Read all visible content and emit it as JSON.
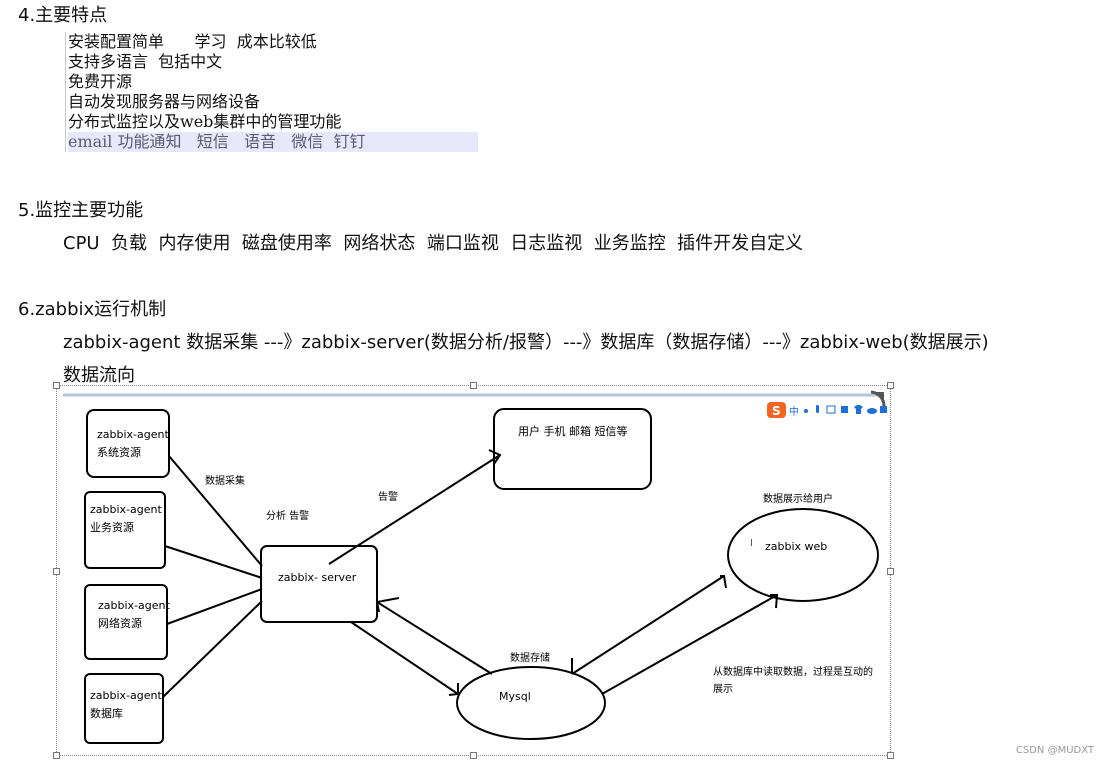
{
  "sections": {
    "s4": {
      "heading": "4.主要特点",
      "lines": [
        "安装配置简单      学习  成本比较低",
        "支持多语言  包括中文",
        "免费开源",
        "自动发现服务器与网络设备",
        "分布式监控以及web集群中的管理功能",
        "email 功能通知   短信   语音   微信  钉钉"
      ]
    },
    "s5": {
      "heading": "5.监控主要功能",
      "content": "CPU  负载  内存使用  磁盘使用率  网络状态  端口监视  日志监视  业务监控  插件开发自定义"
    },
    "s6": {
      "heading": "6.zabbix运行机制",
      "flow": "zabbix-agent 数据采集 ---》zabbix-server(数据分析/报警）---》数据库（数据存储）---》zabbix-web(数据展示)",
      "flow_title": "数据流向"
    }
  },
  "diagram": {
    "agents": [
      {
        "name": "zabbix-agent",
        "sub": "系统资源"
      },
      {
        "name": "zabbix-agent",
        "sub": "业务资源"
      },
      {
        "name": "zabbix-agent",
        "sub": "网络资源"
      },
      {
        "name": "zabbix-agent",
        "sub": "数据库"
      }
    ],
    "server": "zabbix- server",
    "users": "用户 手机 邮箱  短信等",
    "web": "zabbix web",
    "web_cursor": "I",
    "db": "Mysql",
    "labels": {
      "collect": "数据采集",
      "analyze": "分析  告警",
      "alarm": "告警",
      "store": "数据存储",
      "show_to_user": "数据展示给用户",
      "read_db_1": "从数据库中读取数据，过程是互动的",
      "read_db_2": "展示"
    },
    "ime_icons": [
      "sogou-s-icon",
      "zh-icon",
      "dot-icon",
      "mic-icon",
      "keyboard-icon",
      "grid-icon",
      "shirt-icon",
      "cloud-icon",
      "apps-icon"
    ],
    "ime_zh": "中"
  },
  "watermark": "CSDN @MUDXT"
}
